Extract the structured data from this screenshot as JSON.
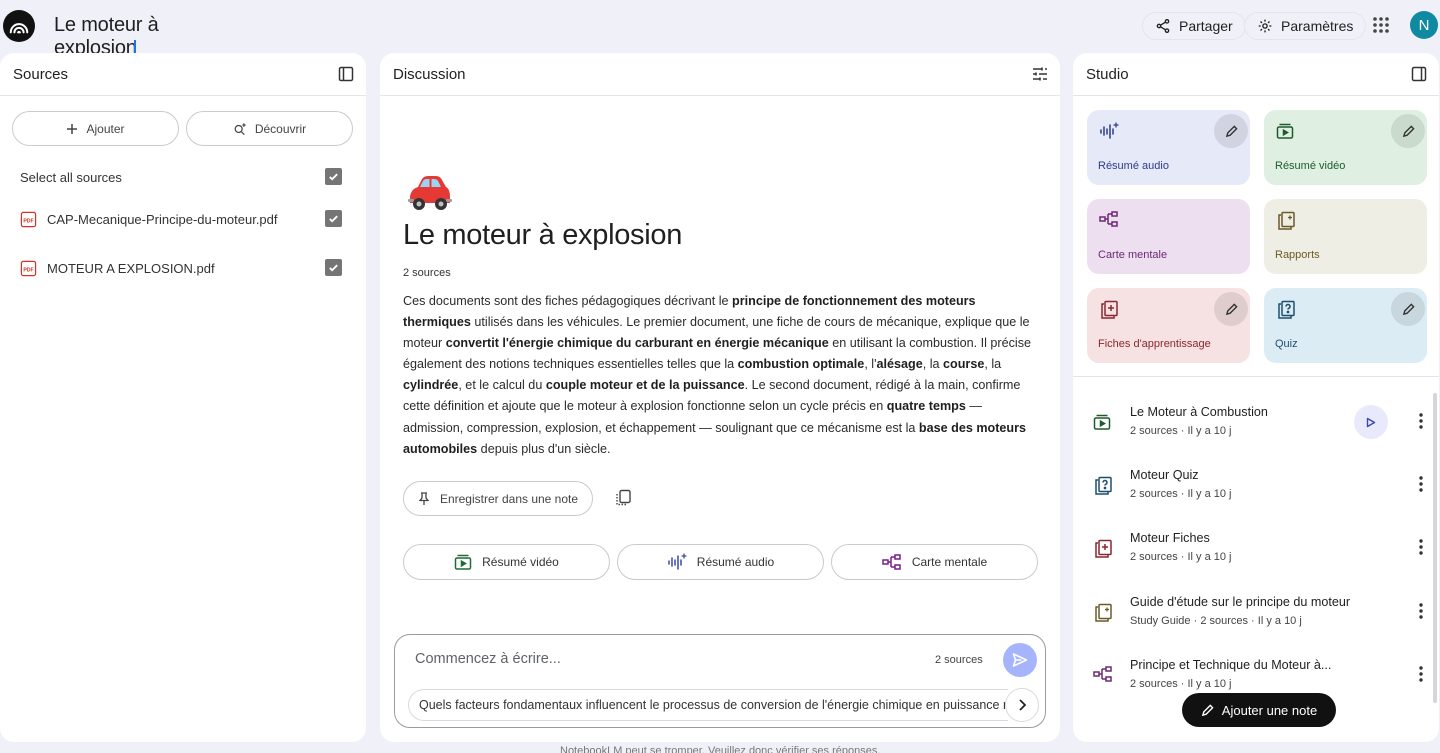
{
  "header": {
    "notebook_title": "Le moteur à explosion",
    "share_label": "Partager",
    "settings_label": "Paramètres",
    "avatar_initial": "N"
  },
  "sources": {
    "title": "Sources",
    "add_label": "Ajouter",
    "discover_label": "Découvrir",
    "select_all_label": "Select all sources",
    "items": [
      {
        "name": "CAP-Mecanique-Principe-du-moteur.pdf",
        "checked": true
      },
      {
        "name": "MOTEUR A EXPLOSION.pdf",
        "checked": true
      }
    ]
  },
  "discussion": {
    "title": "Discussion",
    "emoji": "🚗",
    "notebook_heading": "Le moteur à explosion",
    "source_count": "2 sources",
    "summary_segments": [
      {
        "t": "Ces documents sont des fiches pédagogiques décrivant le ",
        "b": false
      },
      {
        "t": "principe de fonctionnement des moteurs thermiques",
        "b": true
      },
      {
        "t": " utilisés dans les véhicules. Le premier document, une fiche de cours de mécanique, explique que le moteur ",
        "b": false
      },
      {
        "t": "convertit l'énergie chimique du carburant en énergie mécanique",
        "b": true
      },
      {
        "t": " en utilisant la combustion. Il précise également des notions techniques essentielles telles que la ",
        "b": false
      },
      {
        "t": "combustion optimale",
        "b": true
      },
      {
        "t": ", l'",
        "b": false
      },
      {
        "t": "alésage",
        "b": true
      },
      {
        "t": ", la ",
        "b": false
      },
      {
        "t": "course",
        "b": true
      },
      {
        "t": ", la ",
        "b": false
      },
      {
        "t": "cylindrée",
        "b": true
      },
      {
        "t": ", et le calcul du ",
        "b": false
      },
      {
        "t": "couple moteur et de la puissance",
        "b": true
      },
      {
        "t": ". Le second document, rédigé à la main, confirme cette définition et ajoute que le moteur à explosion fonctionne selon un cycle précis en ",
        "b": false
      },
      {
        "t": "quatre temps",
        "b": true
      },
      {
        "t": " — admission, compression, explosion, et échappement — soulignant que ce mécanisme est la ",
        "b": false
      },
      {
        "t": "base des moteurs automobiles",
        "b": true
      },
      {
        "t": " depuis plus d'un siècle.",
        "b": false
      }
    ],
    "save_note_label": "Enregistrer dans une note",
    "quick_actions": [
      "Résumé vidéo",
      "Résumé audio",
      "Carte mentale"
    ],
    "input_placeholder": "Commencez à écrire...",
    "input_value": "",
    "input_source_count": "2 sources",
    "suggestion": "Quels facteurs fondamentaux influencent le processus de conversion de l'énergie chimique en puissance mécanique"
  },
  "studio": {
    "title": "Studio",
    "tiles": {
      "audio": "Résumé audio",
      "video": "Résumé vidéo",
      "mind": "Carte mentale",
      "report": "Rapports",
      "cards": "Fiches d'apprentissage",
      "quiz": "Quiz"
    },
    "notes": [
      {
        "title": "Le Moteur à Combustion",
        "meta": "2 sources · Il y a 10 j"
      },
      {
        "title": "Moteur Quiz",
        "meta": "2 sources · Il y a 10 j"
      },
      {
        "title": "Moteur Fiches",
        "meta": "2 sources · Il y a 10 j"
      },
      {
        "title": "Guide d'étude sur le principe du moteur",
        "meta": "Study Guide · 2 sources · Il y a 10 j"
      },
      {
        "title": "Principe et Technique du Moteur à...",
        "meta": "2 sources · Il y a 10 j"
      }
    ],
    "add_note_label": "Ajouter une note"
  },
  "footer": {
    "disclaimer": "NotebookLM peut se tromper. Veuillez donc vérifier ses réponses."
  },
  "colors": {
    "background": "#f0f1f8",
    "send_button": "#a5b4fc",
    "avatar": "#0f8aa0"
  },
  "icons": [
    "notebooklm-logo-icon",
    "share-icon",
    "gear-icon",
    "apps-grid-icon",
    "panel-toggle-icon",
    "plus-icon",
    "discover-icon",
    "pdf-icon",
    "check-icon",
    "tune-icon",
    "pin-icon",
    "copy-icon",
    "video-icon",
    "audio-spark-icon",
    "mind-map-icon",
    "send-icon",
    "chevron-right-icon",
    "pencil-icon",
    "report-icon",
    "flashcards-icon",
    "quiz-icon",
    "play-icon",
    "more-vert-icon"
  ]
}
